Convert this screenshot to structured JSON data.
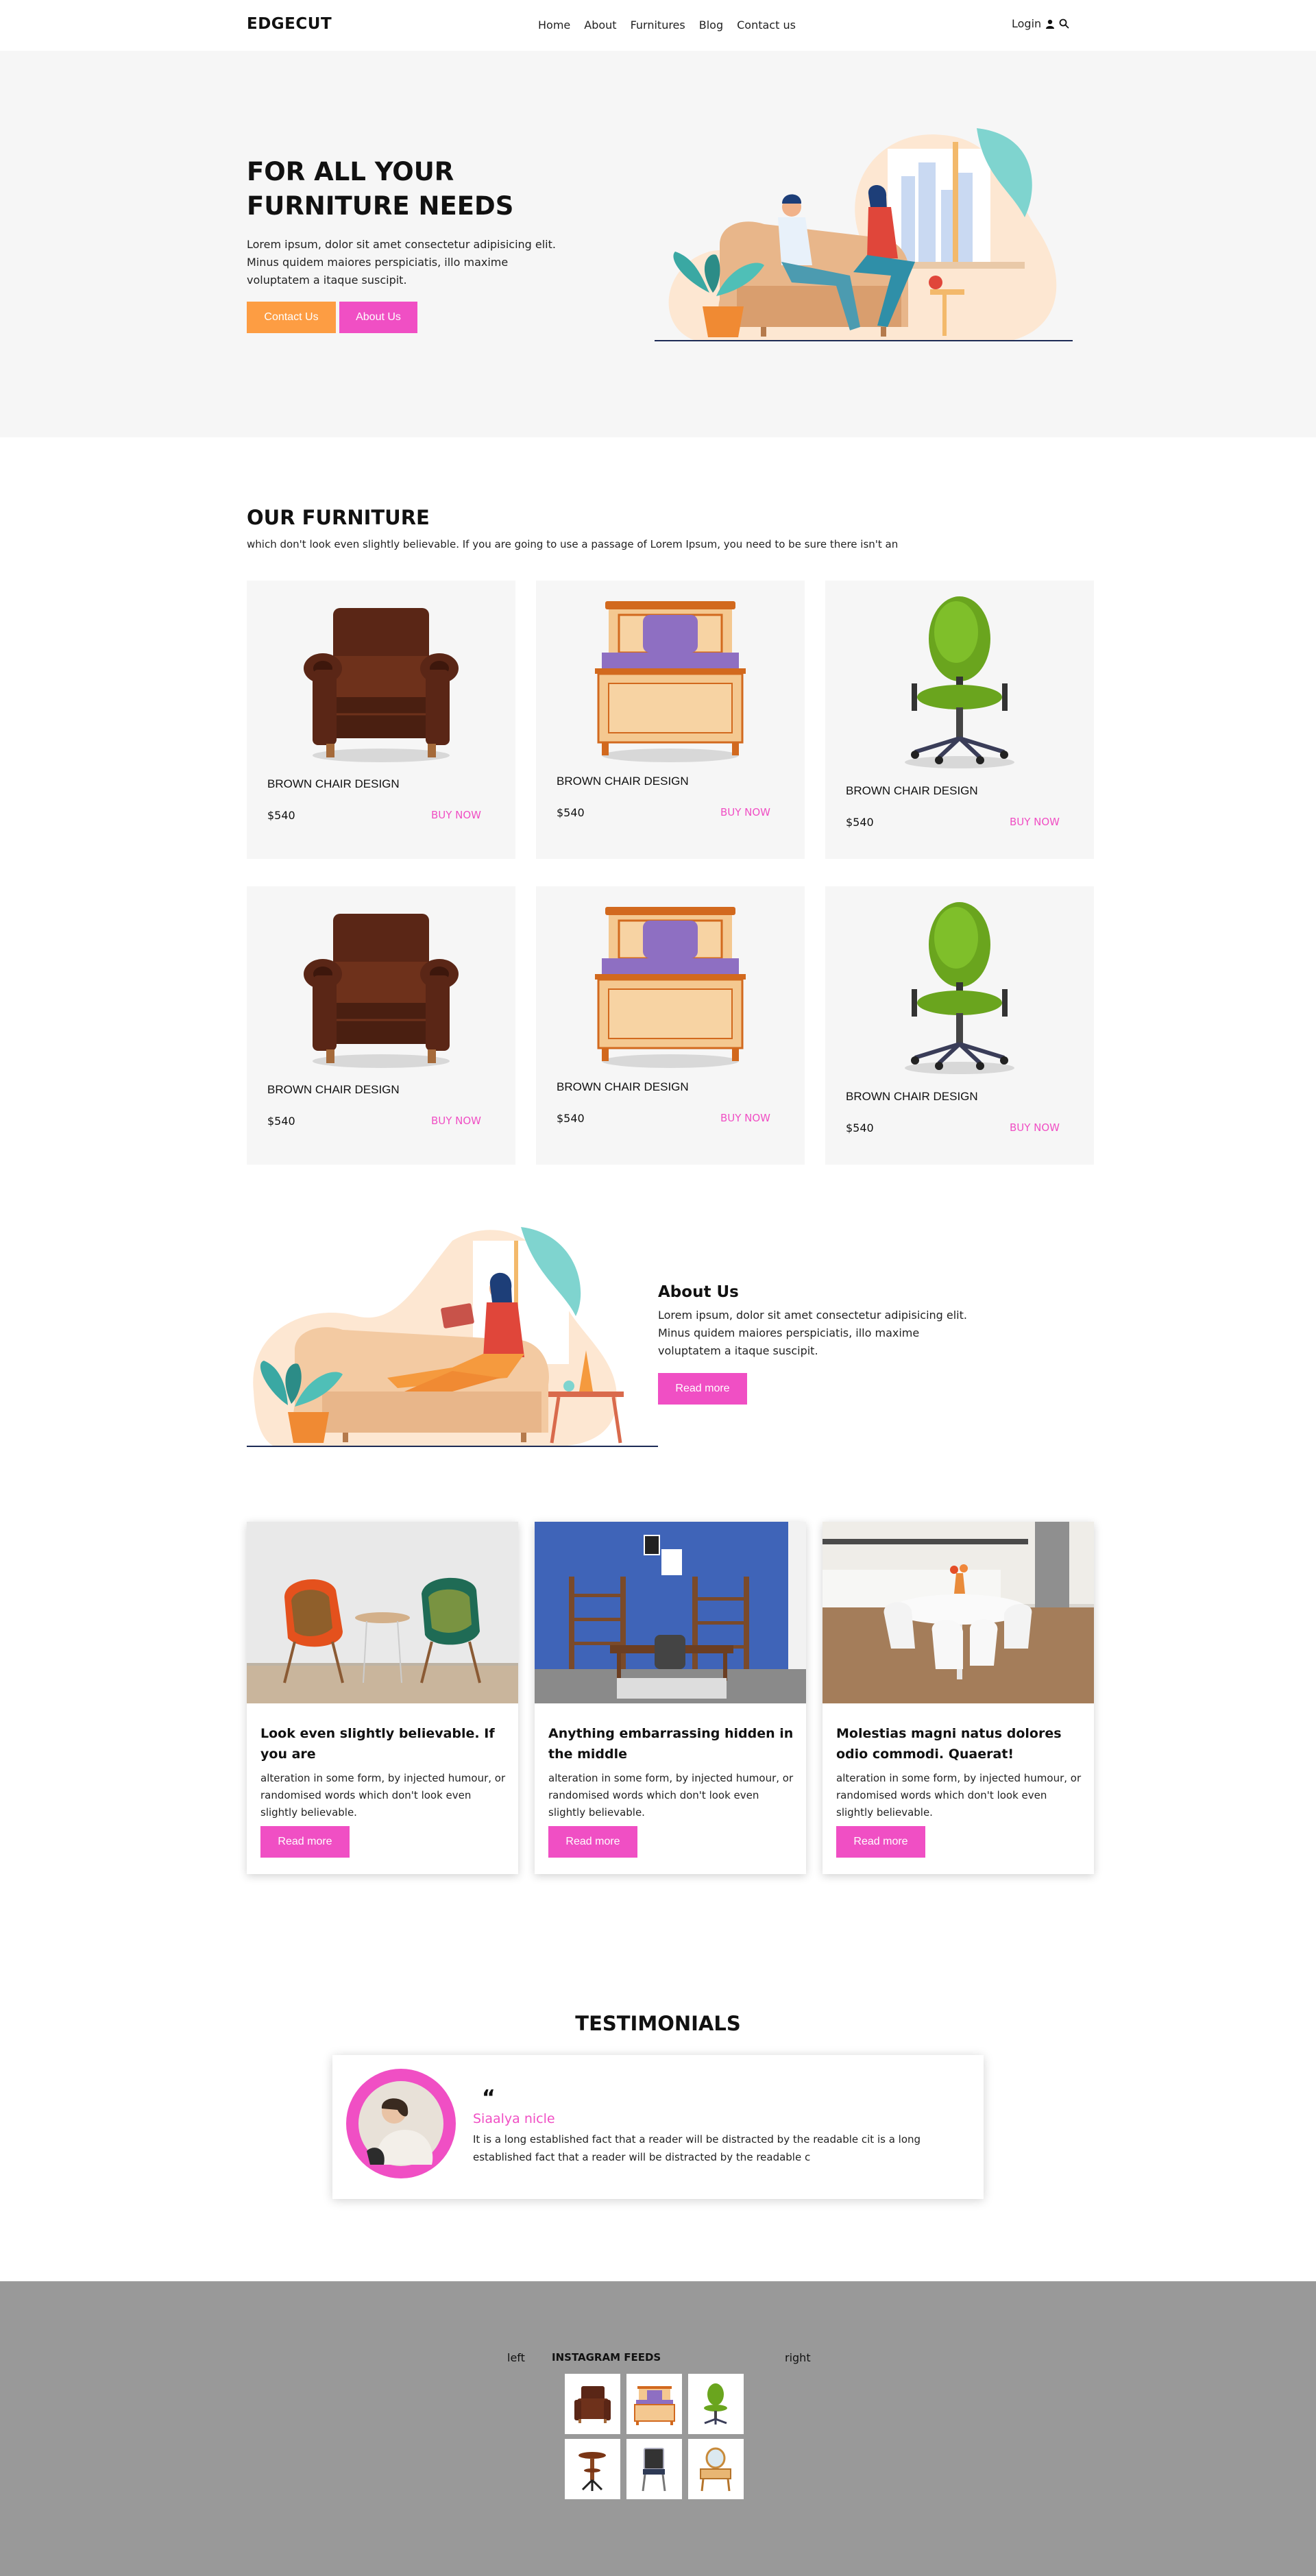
{
  "nav": {
    "brand": "EDGECUT",
    "links": [
      "Home",
      "About",
      "Furnitures",
      "Blog",
      "Contact us"
    ],
    "login": "Login"
  },
  "hero": {
    "title": "FOR ALL YOUR FURNITURE NEEDS",
    "text": "Lorem ipsum, dolor sit amet consectetur adipisicing elit. Minus quidem maiores perspiciatis, illo maxime voluptatem a itaque suscipit.",
    "contact_btn": "Contact Us",
    "about_btn": "About Us"
  },
  "furniture": {
    "title": "OUR FURNITURE",
    "subtitle": "which don't look even slightly believable. If you are going to use a passage of Lorem Ipsum, you need to be sure there isn't an",
    "items": [
      {
        "name": "BROWN CHAIR DESIGN",
        "price": "$540",
        "buy": "BUY NOW",
        "icon": "armchair-icon"
      },
      {
        "name": "BROWN CHAIR DESIGN",
        "price": "$540",
        "buy": "BUY NOW",
        "icon": "bed-icon"
      },
      {
        "name": "BROWN CHAIR DESIGN",
        "price": "$540",
        "buy": "BUY NOW",
        "icon": "office-chair-icon"
      },
      {
        "name": "BROWN CHAIR DESIGN",
        "price": "$540",
        "buy": "BUY NOW",
        "icon": "armchair-icon"
      },
      {
        "name": "BROWN CHAIR DESIGN",
        "price": "$540",
        "buy": "BUY NOW",
        "icon": "bed-icon"
      },
      {
        "name": "BROWN CHAIR DESIGN",
        "price": "$540",
        "buy": "BUY NOW",
        "icon": "office-chair-icon"
      }
    ]
  },
  "about": {
    "title": "About Us",
    "text": "Lorem ipsum, dolor sit amet consectetur adipisicing elit. Minus quidem maiores perspiciatis, illo maxime voluptatem a itaque suscipit.",
    "button": "Read more"
  },
  "blog": [
    {
      "title": "Look even slightly believable. If you are",
      "text": "alteration in some form, by injected humour, or randomised words which don't look even slightly believable.",
      "button": "Read more"
    },
    {
      "title": "Anything embarrassing hidden in the middle",
      "text": "alteration in some form, by injected humour, or randomised words which don't look even slightly believable.",
      "button": "Read more"
    },
    {
      "title": "Molestias magni natus dolores odio commodi. Quaerat!",
      "text": "alteration in some form, by injected humour, or randomised words which don't look even slightly believable.",
      "button": "Read more"
    }
  ],
  "testimonials": {
    "title": "TESTIMONIALS",
    "quote_mark": "“",
    "name": "Siaalya nicle",
    "text": "It is a long established fact that a reader will be distracted by the readable cit is a long established fact that a reader will be distracted by the readable c"
  },
  "footer": {
    "left": "left",
    "title": "INSTAGRAM FEEDS",
    "right": "right"
  },
  "colors": {
    "accent_pink": "#f04fc4",
    "accent_orange": "#fd9d43",
    "hero_bg": "#f6f6f6",
    "footer_bg": "#999999"
  }
}
